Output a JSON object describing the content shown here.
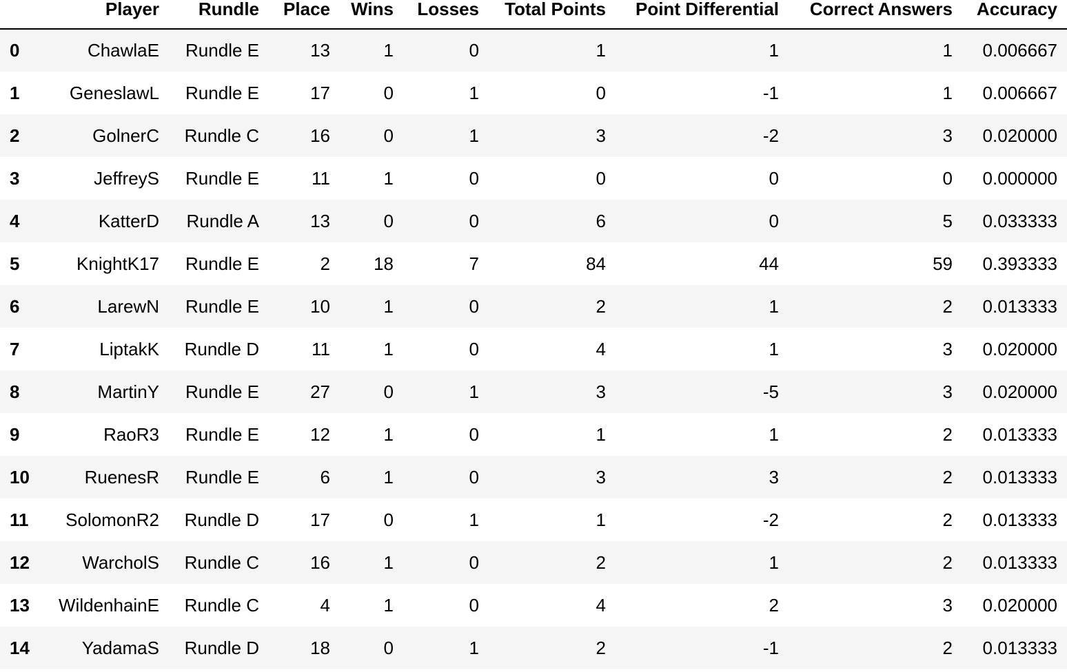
{
  "table": {
    "columns": [
      "Player",
      "Rundle",
      "Place",
      "Wins",
      "Losses",
      "Total Points",
      "Point Differential",
      "Correct Answers",
      "Accuracy"
    ],
    "rows": [
      {
        "index": "0",
        "cells": [
          "ChawlaE",
          "Rundle E",
          "13",
          "1",
          "0",
          "1",
          "1",
          "1",
          "0.006667"
        ]
      },
      {
        "index": "1",
        "cells": [
          "GeneslawL",
          "Rundle E",
          "17",
          "0",
          "1",
          "0",
          "-1",
          "1",
          "0.006667"
        ]
      },
      {
        "index": "2",
        "cells": [
          "GolnerC",
          "Rundle C",
          "16",
          "0",
          "1",
          "3",
          "-2",
          "3",
          "0.020000"
        ]
      },
      {
        "index": "3",
        "cells": [
          "JeffreyS",
          "Rundle E",
          "11",
          "1",
          "0",
          "0",
          "0",
          "0",
          "0.000000"
        ]
      },
      {
        "index": "4",
        "cells": [
          "KatterD",
          "Rundle A",
          "13",
          "0",
          "0",
          "6",
          "0",
          "5",
          "0.033333"
        ]
      },
      {
        "index": "5",
        "cells": [
          "KnightK17",
          "Rundle E",
          "2",
          "18",
          "7",
          "84",
          "44",
          "59",
          "0.393333"
        ]
      },
      {
        "index": "6",
        "cells": [
          "LarewN",
          "Rundle E",
          "10",
          "1",
          "0",
          "2",
          "1",
          "2",
          "0.013333"
        ]
      },
      {
        "index": "7",
        "cells": [
          "LiptakK",
          "Rundle D",
          "11",
          "1",
          "0",
          "4",
          "1",
          "3",
          "0.020000"
        ]
      },
      {
        "index": "8",
        "cells": [
          "MartinY",
          "Rundle E",
          "27",
          "0",
          "1",
          "3",
          "-5",
          "3",
          "0.020000"
        ]
      },
      {
        "index": "9",
        "cells": [
          "RaoR3",
          "Rundle E",
          "12",
          "1",
          "0",
          "1",
          "1",
          "2",
          "0.013333"
        ]
      },
      {
        "index": "10",
        "cells": [
          "RuenesR",
          "Rundle E",
          "6",
          "1",
          "0",
          "3",
          "3",
          "2",
          "0.013333"
        ]
      },
      {
        "index": "11",
        "cells": [
          "SolomonR2",
          "Rundle D",
          "17",
          "0",
          "1",
          "1",
          "-2",
          "2",
          "0.013333"
        ]
      },
      {
        "index": "12",
        "cells": [
          "WarcholS",
          "Rundle C",
          "16",
          "1",
          "0",
          "2",
          "1",
          "2",
          "0.013333"
        ]
      },
      {
        "index": "13",
        "cells": [
          "WildenhainE",
          "Rundle C",
          "4",
          "1",
          "0",
          "4",
          "2",
          "3",
          "0.020000"
        ]
      },
      {
        "index": "14",
        "cells": [
          "YadamaS",
          "Rundle D",
          "18",
          "0",
          "1",
          "2",
          "-1",
          "2",
          "0.013333"
        ]
      }
    ]
  }
}
